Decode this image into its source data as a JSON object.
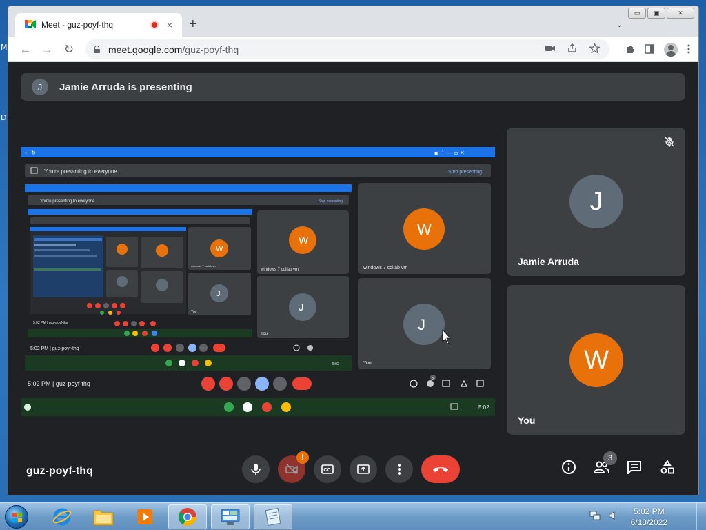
{
  "browser": {
    "tab_title": "Meet - guz-poyf-thq",
    "tab_close": "×",
    "new_tab": "+",
    "tab_search": "⌄",
    "url_host": "meet.google.com",
    "url_path": "/guz-poyf-thq",
    "back": "←",
    "forward": "→",
    "reload": "↻",
    "min": "▭",
    "max": "▣",
    "close": "✕"
  },
  "meet": {
    "banner_avatar": "J",
    "banner_text": "Jamie Arruda is presenting",
    "meeting_code": "guz-poyf-thq",
    "people_count": "3",
    "cam_alert": "!",
    "tiles": [
      {
        "initial": "J",
        "name": "Jamie Arruda",
        "avatar_color": "#5f6b77"
      },
      {
        "initial": "W",
        "name": "You",
        "avatar_color": "#e8710a"
      }
    ]
  },
  "shared_screen": {
    "banner": "You're presenting to everyone",
    "stop": "Stop presenting",
    "time_code": "5:02 PM  |  guz-poyf-thq",
    "small_time_code": "5:02 PM  |  guz-poyf-thq",
    "tile_w_name": "windows 7 collab vm",
    "tile_j_name": "You",
    "tile_w_initial": "W",
    "tile_j_initial": "J",
    "clock": "5:02",
    "badge": "3"
  },
  "taskbar": {
    "time": "5:02 PM",
    "date": "6/18/2022"
  },
  "desktop": {
    "glyph1": "M",
    "glyph2": "D"
  },
  "colors": {
    "meet_bg": "#202124",
    "tile_bg": "#3c4043",
    "red": "#ea4335",
    "orange": "#e8710a"
  }
}
